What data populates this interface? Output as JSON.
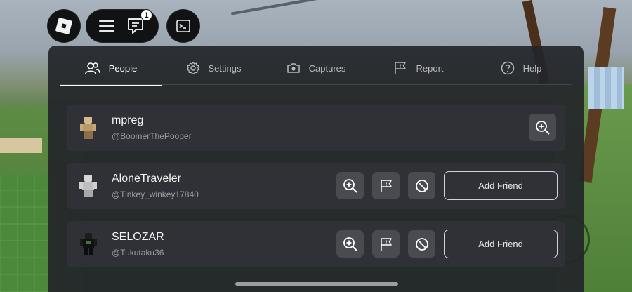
{
  "top_bar": {
    "roblox_icon": "roblox-logo-icon",
    "menu_icon": "hamburger-icon",
    "chat_icon": "chat-icon",
    "chat_badge": "1",
    "console_icon": "terminal-icon"
  },
  "tabs": [
    {
      "label": "People",
      "icon": "people-icon",
      "active": true
    },
    {
      "label": "Settings",
      "icon": "gear-icon",
      "active": false
    },
    {
      "label": "Captures",
      "icon": "camera-icon",
      "active": false
    },
    {
      "label": "Report",
      "icon": "flag-icon",
      "active": false
    },
    {
      "label": "Help",
      "icon": "help-icon",
      "active": false
    }
  ],
  "players": [
    {
      "display_name": "mpreg",
      "username": "@BoomerThePooper"
    },
    {
      "display_name": "AloneTraveler",
      "username": "@Tinkey_winkey17840",
      "add_friend_label": "Add Friend"
    },
    {
      "display_name": "SELOZAR",
      "username": "@Tukutaku36",
      "add_friend_label": "Add Friend"
    }
  ],
  "colors": {
    "panel_bg": "#24262a",
    "row_bg": "#2f3136",
    "button_bg": "#494b50",
    "text_primary": "#f2f2f2",
    "text_secondary": "#9a9ca0"
  }
}
